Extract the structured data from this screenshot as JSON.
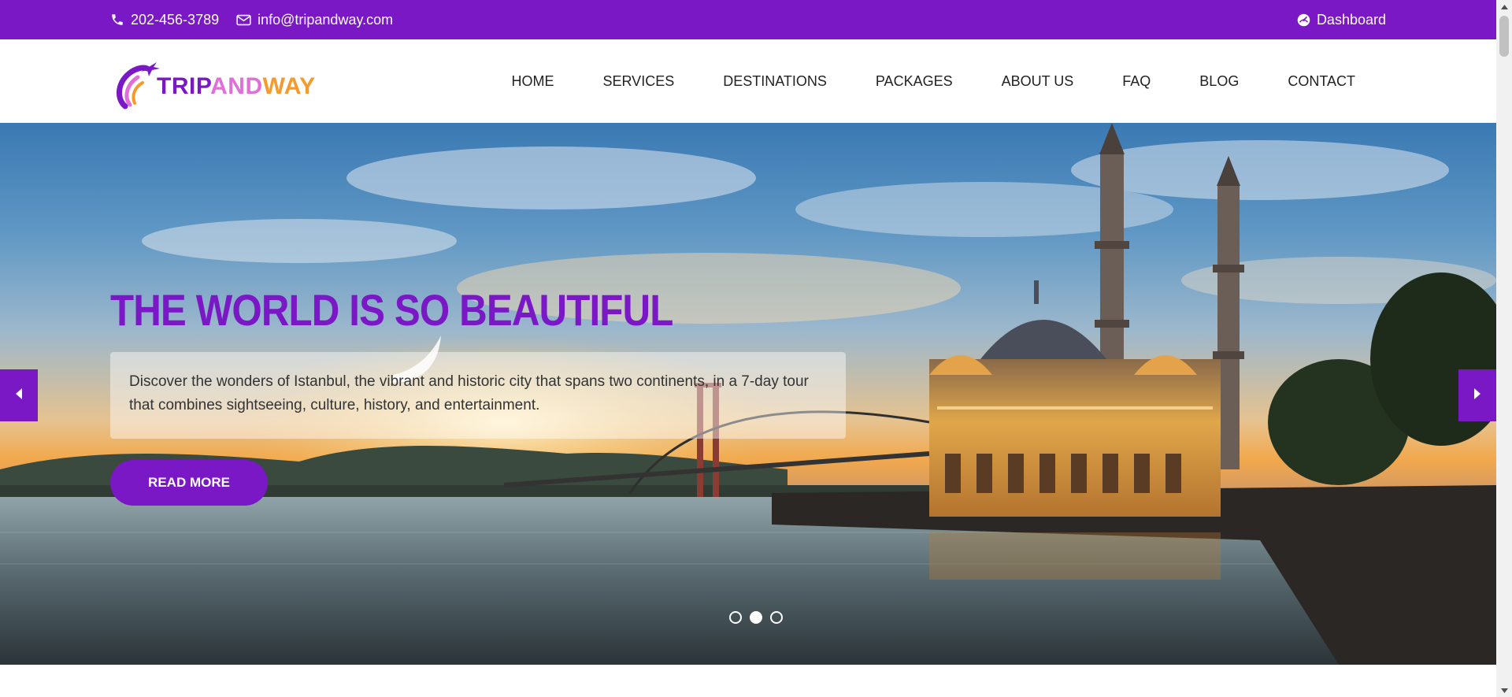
{
  "topbar": {
    "phone": "202-456-3789",
    "email": "info@tripandway.com",
    "dashboard_label": "Dashboard"
  },
  "logo": {
    "part1": "TRIP",
    "part2": "AND",
    "part3": "WAY"
  },
  "nav": {
    "items": [
      {
        "label": "HOME"
      },
      {
        "label": "SERVICES"
      },
      {
        "label": "DESTINATIONS"
      },
      {
        "label": "PACKAGES"
      },
      {
        "label": "ABOUT US"
      },
      {
        "label": "FAQ"
      },
      {
        "label": "BLOG"
      },
      {
        "label": "CONTACT"
      }
    ]
  },
  "hero": {
    "title": "THE WORLD IS SO BEAUTIFUL",
    "description": "Discover the wonders of Istanbul, the vibrant and historic city that spans two continents, in a 7-day tour that combines sightseeing, culture, history, and entertainment.",
    "button_label": "READ MORE",
    "slide_count": 3,
    "active_slide": 2
  },
  "colors": {
    "brand": "#7a18c6",
    "logo_and": "#e06fd9",
    "logo_way": "#f59a2e"
  },
  "icons": {
    "phone": "phone-icon",
    "email": "envelope-icon",
    "dashboard": "dashboard-icon",
    "prev": "caret-left-icon",
    "next": "caret-right-icon"
  }
}
